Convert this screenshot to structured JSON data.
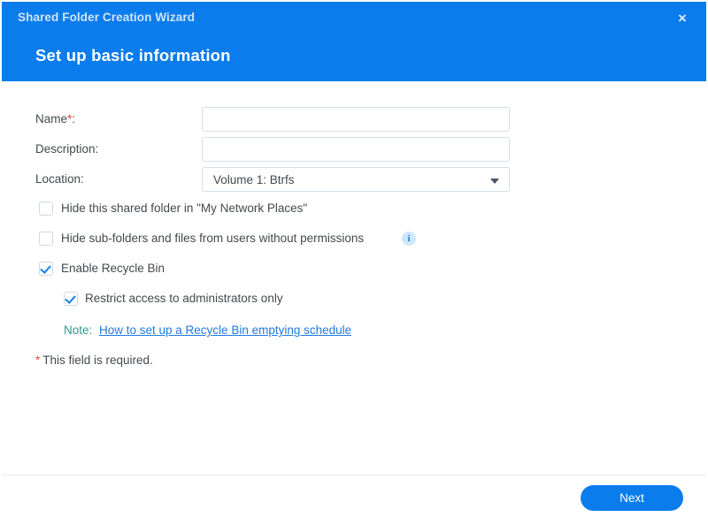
{
  "window": {
    "title": "Shared Folder Creation Wizard",
    "close_label": "×",
    "step_title": "Set up basic information",
    "accent_color": "#0a7cec"
  },
  "form": {
    "name": {
      "label": "Name",
      "required_marker": "*",
      "suffix": ":",
      "value": "",
      "placeholder": ""
    },
    "description": {
      "label": "Description:",
      "value": "",
      "placeholder": ""
    },
    "location": {
      "label": "Location:",
      "value": "Volume 1:  Btrfs",
      "icon": "chevron-down-icon"
    }
  },
  "options": [
    {
      "label": "Hide this shared folder in \"My Network Places\"",
      "checked": false,
      "has_info": false
    },
    {
      "label": "Hide sub-folders and files from users without permissions",
      "checked": false,
      "has_info": true,
      "info_icon": "info-icon"
    },
    {
      "label": "Enable Recycle Bin",
      "checked": true,
      "has_info": false
    }
  ],
  "sub_option": {
    "label": "Restrict access to administrators only",
    "checked": true
  },
  "note": {
    "prefix": "Note:",
    "link_text": "How to set up a Recycle Bin emptying schedule",
    "prefix_color": "#2b9d8f",
    "link_color": "#1f7ae0"
  },
  "required_note": {
    "marker": "*",
    "text": "This field is required.",
    "marker_color": "#e8443b"
  },
  "footer": {
    "next_label": "Next"
  }
}
